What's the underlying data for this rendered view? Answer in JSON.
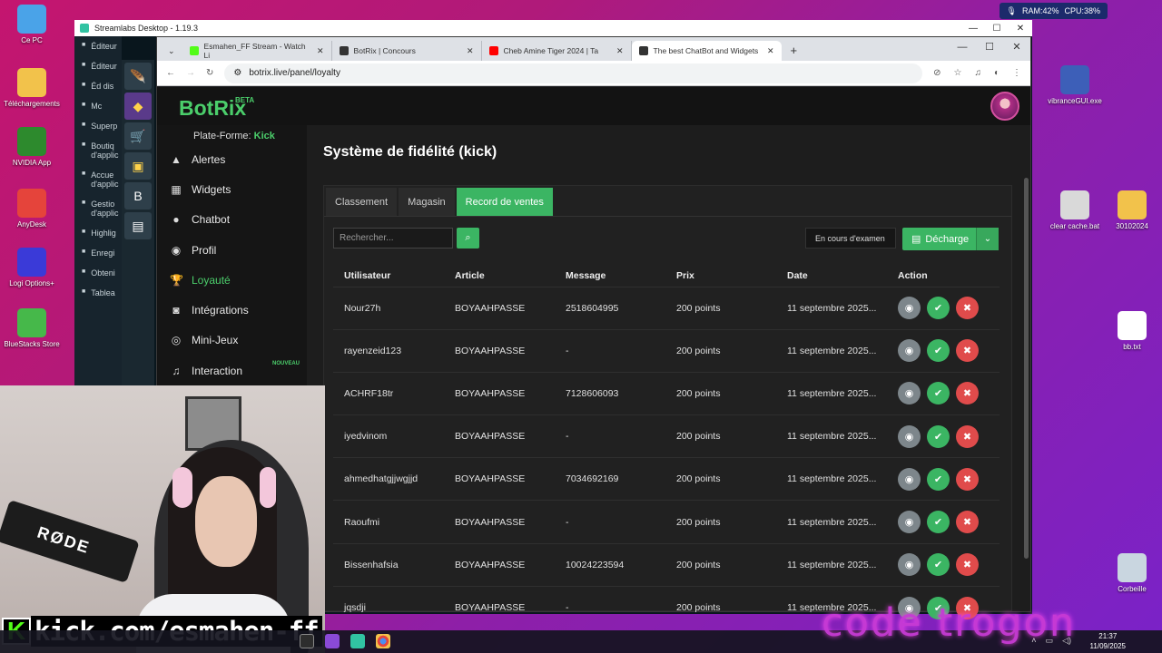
{
  "desktop": {
    "icons_left": [
      {
        "label": "Ce PC",
        "icon": "computer-icon",
        "color": "#4aa3e8"
      },
      {
        "label": "Téléchargements",
        "icon": "folder-download-icon",
        "color": "#f2c24b"
      },
      {
        "label": "NVIDIA App",
        "icon": "nvidia-icon",
        "color": "#2d8a2d"
      },
      {
        "label": "AnyDesk",
        "icon": "anydesk-icon",
        "color": "#e5443b"
      },
      {
        "label": "Logi Options+",
        "icon": "logi-icon",
        "color": "#3a3ad8"
      },
      {
        "label": "BlueStacks Store",
        "icon": "bluestacks-icon",
        "color": "#46b84a"
      }
    ],
    "icons_right": [
      {
        "label": "vibranceGUI.exe",
        "icon": "gear-icon",
        "color": "#3d5fb8"
      },
      {
        "label": "clear cache.bat",
        "icon": "bat-file-icon",
        "color": "#d9d9d9"
      },
      {
        "label": "30102024",
        "icon": "folder-icon",
        "color": "#f2c24b"
      },
      {
        "label": "bb.txt",
        "icon": "text-file-icon",
        "color": "#ffffff"
      },
      {
        "label": "Corbeille",
        "icon": "recycle-bin-icon",
        "color": "#c9d6e0"
      }
    ],
    "sysmon": {
      "ram": "RAM:42%",
      "cpu": "CPU:38%"
    }
  },
  "streamlabs": {
    "title": "Streamlabs Desktop - 1.19.3",
    "sidebar": [
      "Éditeur",
      "Éditeur",
      "Éd dis",
      "Mc",
      "Superp",
      "Boutiq d'applic",
      "Accue d'applic",
      "Gestio d'applic",
      "Highlig",
      "Enregi",
      "Obteni",
      "Tablea"
    ]
  },
  "browser": {
    "tabs": [
      {
        "label": "Esmahen_FF Stream - Watch Li",
        "color": "#53fc18"
      },
      {
        "label": "BotRix | Concours",
        "color": "#333333"
      },
      {
        "label": "Cheb Amine Tiger 2024 | Ta",
        "color": "#ff0000"
      },
      {
        "label": "The best ChatBot and Widgets",
        "color": "#333333"
      }
    ],
    "url": "botrix.live/panel/loyalty"
  },
  "app": {
    "logo": "BotRix",
    "beta": "BETA",
    "platform_label": "Plate-Forme:",
    "platform_value": "Kick",
    "nav": [
      {
        "label": "Alertes",
        "icon": "warning-icon"
      },
      {
        "label": "Widgets",
        "icon": "widgets-icon"
      },
      {
        "label": "Chatbot",
        "icon": "chatbot-icon"
      },
      {
        "label": "Profil",
        "icon": "user-icon"
      },
      {
        "label": "Loyauté",
        "icon": "trophy-icon"
      },
      {
        "label": "Intégrations",
        "icon": "discord-icon"
      },
      {
        "label": "Mini-Jeux",
        "icon": "gamepad-icon"
      },
      {
        "label": "Interaction",
        "icon": "music-icon",
        "badge": "NOUVEAU"
      }
    ],
    "page_title": "Système de fidélité (kick)",
    "tabs": [
      "Classement",
      "Magasin",
      "Record de ventes"
    ],
    "search_placeholder": "Rechercher...",
    "status_select": "En cours d'examen",
    "download_label": "Décharge",
    "table": {
      "headers": [
        "Utilisateur",
        "Article",
        "Message",
        "Prix",
        "Date",
        "Action"
      ],
      "rows": [
        {
          "user": "Nour27h",
          "article": "BOYAAHPASSE",
          "message": "2518604995",
          "price": "200 points",
          "date": "11 septembre 2025..."
        },
        {
          "user": "rayenzeid123",
          "article": "BOYAAHPASSE",
          "message": "-",
          "price": "200 points",
          "date": "11 septembre 2025..."
        },
        {
          "user": "ACHRF18tr",
          "article": "BOYAAHPASSE",
          "message": "7128606093",
          "price": "200 points",
          "date": "11 septembre 2025..."
        },
        {
          "user": "iyedvinom",
          "article": "BOYAAHPASSE",
          "message": "-",
          "price": "200 points",
          "date": "11 septembre 2025..."
        },
        {
          "user": "ahmedhatgjjwgjjd",
          "article": "BOYAAHPASSE",
          "message": "7034692169",
          "price": "200 points",
          "date": "11 septembre 2025..."
        },
        {
          "user": "Raoufmi",
          "article": "BOYAAHPASSE",
          "message": "-",
          "price": "200 points",
          "date": "11 septembre 2025..."
        },
        {
          "user": "Bissenhafsia",
          "article": "BOYAAHPASSE",
          "message": "10024223594",
          "price": "200 points",
          "date": "11 septembre 2025..."
        },
        {
          "user": "jqsdji",
          "article": "BOYAAHPASSE",
          "message": "-",
          "price": "200 points",
          "date": "11 septembre 2025..."
        }
      ]
    }
  },
  "overlay": {
    "kick_k": "K",
    "kick_url": "kick.com/esmahen-ff",
    "neon_text": "code trogon",
    "mic_brand": "RØDE"
  },
  "taskbar": {
    "time": "21:37",
    "date": "11/09/2025"
  }
}
